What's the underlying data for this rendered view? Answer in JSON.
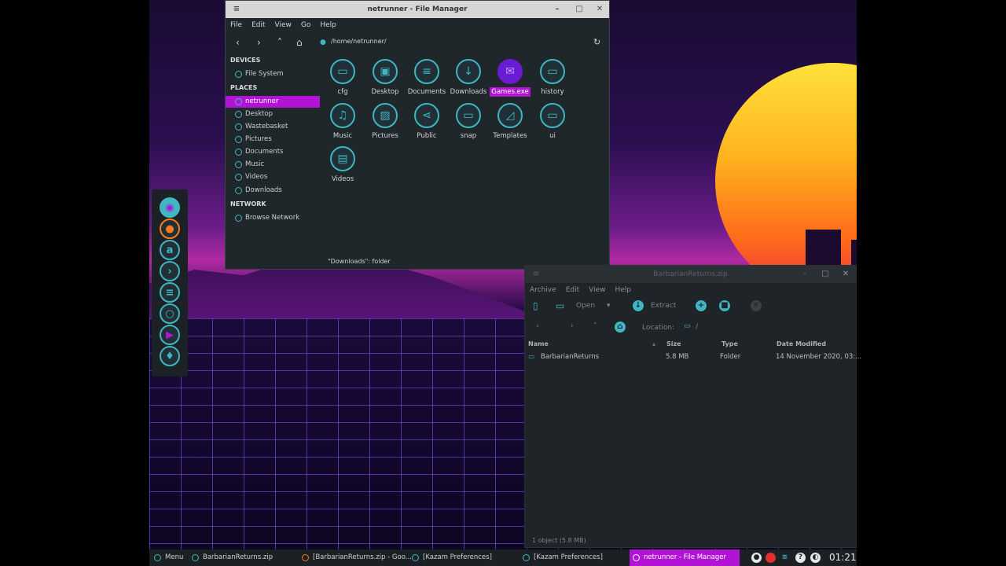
{
  "file_manager": {
    "title": "netrunner - File Manager",
    "menu": [
      "File",
      "Edit",
      "View",
      "Go",
      "Help"
    ],
    "path": "/home/netrunner/",
    "sidebar": {
      "devices_header": "DEVICES",
      "devices": [
        "File System"
      ],
      "places_header": "PLACES",
      "places": [
        "netrunner",
        "Desktop",
        "Wastebasket",
        "Pictures",
        "Documents",
        "Music",
        "Videos",
        "Downloads"
      ],
      "network_header": "NETWORK",
      "network": [
        "Browse Network"
      ]
    },
    "files": [
      "cfg",
      "Desktop",
      "Documents",
      "Downloads",
      "Games.exe",
      "history",
      "Music",
      "Pictures",
      "Public",
      "snap",
      "Templates",
      "ui",
      "Videos"
    ],
    "selected_file": "Games.exe",
    "status": "\"Downloads\": folder"
  },
  "archive": {
    "title": "BarbarianReturns.zip",
    "menu": [
      "Archive",
      "Edit",
      "View",
      "Help"
    ],
    "open_label": "Open",
    "extract_label": "Extract",
    "location_label": "Location:",
    "location_value": "/",
    "columns": {
      "name": "Name",
      "size": "Size",
      "type": "Type",
      "date": "Date Modified"
    },
    "row": {
      "name": "BarbarianReturns",
      "size": "5.8 MB",
      "type": "Folder",
      "date": "14 November 2020, 03:..."
    },
    "status": "1 object (5.8 MB)"
  },
  "taskbar": {
    "menu": "Menu",
    "tasks": [
      "BarbarianReturns.zip",
      "[BarbarianReturns.zip - Goo...",
      "[Kazam Preferences]",
      "[Kazam Preferences]",
      "netrunner - File Manager"
    ],
    "clock": "01:21"
  },
  "colors": {
    "accent": "#3fb7c3",
    "highlight": "#b214d6"
  },
  "icons": {
    "tray": [
      "chat-icon",
      "record-icon",
      "network-icon",
      "help-icon",
      "volume-icon"
    ]
  }
}
